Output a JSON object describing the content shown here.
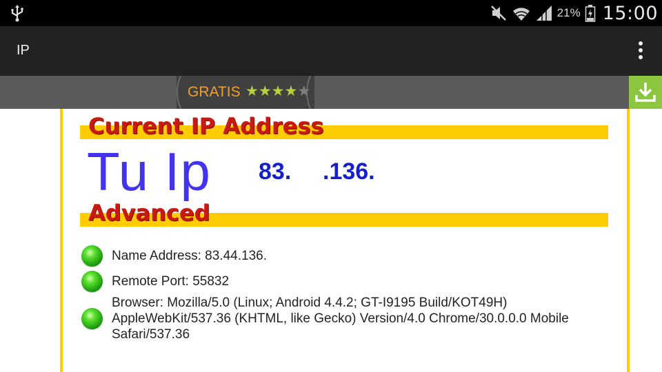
{
  "statusbar": {
    "battery_percent": "21%",
    "clock": "15:00",
    "icons": [
      "usb-icon",
      "mute-icon",
      "wifi-icon",
      "signal-icon",
      "battery-icon"
    ]
  },
  "actionbar": {
    "title": "IP",
    "menu_icon": "overflow-menu-icon"
  },
  "ad": {
    "label": "GRATIS",
    "stars_on": "★★★★",
    "stars_off": "★",
    "rating": 4,
    "rating_max": 5,
    "download_icon": "download-icon"
  },
  "main": {
    "current_heading": "Current IP Address",
    "tu_ip_label": "Tu Ip",
    "ip_part1": "83.",
    "ip_part2": ".136.",
    "advanced_heading": "Advanced",
    "details": [
      {
        "text": "Name Address: 83.44.136."
      },
      {
        "text": "Remote Port: 55832"
      },
      {
        "text": "Browser: Mozilla/5.0 (Linux; Android 4.4.2; GT-I9195 Build/KOT49H) AppleWebKit/537.36 (KHTML, like Gecko) Version/4.0 Chrome/30.0.0.0 Mobile Safari/537.36"
      }
    ]
  },
  "colors": {
    "accent_yellow": "#ffcc00",
    "heading_red": "#c81a10",
    "ip_blue": "#1520cc",
    "download_green": "#8cc63f"
  }
}
